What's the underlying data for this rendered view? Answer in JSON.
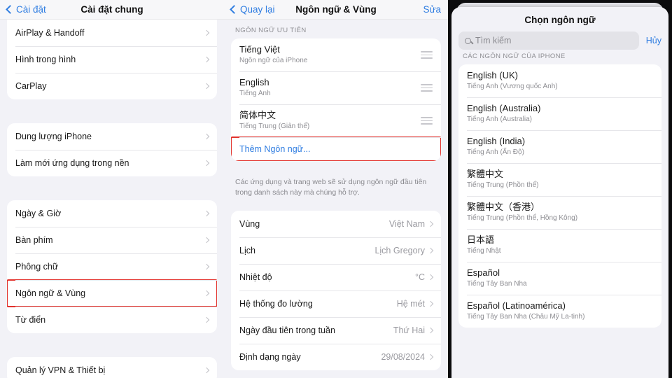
{
  "panels": {
    "left": {
      "nav": {
        "back_label": "Cài đặt",
        "title": "Cài đặt chung"
      },
      "groups": [
        {
          "rows": [
            {
              "label": "AirPlay & Handoff"
            },
            {
              "label": "Hình trong hình"
            },
            {
              "label": "CarPlay"
            }
          ]
        },
        {
          "rows": [
            {
              "label": "Dung lượng iPhone"
            },
            {
              "label": "Làm mới ứng dụng trong nền"
            }
          ]
        },
        {
          "rows": [
            {
              "label": "Ngày & Giờ"
            },
            {
              "label": "Bàn phím"
            },
            {
              "label": "Phông chữ"
            },
            {
              "label": "Ngôn ngữ & Vùng",
              "highlighted": true
            },
            {
              "label": "Từ điển"
            }
          ]
        },
        {
          "rows": [
            {
              "label": "Quản lý VPN & Thiết bị"
            }
          ]
        }
      ]
    },
    "middle": {
      "nav": {
        "back_label": "Quay lại",
        "title": "Ngôn ngữ & Vùng",
        "edit_label": "Sửa"
      },
      "section_header": "NGÔN NGỮ ƯU TIÊN",
      "languages": [
        {
          "name": "Tiếng Việt",
          "sub": "Ngôn ngữ của iPhone"
        },
        {
          "name": "English",
          "sub": "Tiếng Anh"
        },
        {
          "name": "简体中文",
          "sub": "Tiếng Trung (Giản thể)"
        }
      ],
      "add_language_label": "Thêm Ngôn ngữ...",
      "footer": "Các ứng dụng và trang web sẽ sử dụng ngôn ngữ đầu tiên trong danh sách này mà chúng hỗ trợ.",
      "region_rows": [
        {
          "label": "Vùng",
          "value": "Việt Nam"
        },
        {
          "label": "Lịch",
          "value": "Lịch Gregory"
        },
        {
          "label": "Nhiệt độ",
          "value": "°C"
        },
        {
          "label": "Hệ thống đo lường",
          "value": "Hệ mét"
        },
        {
          "label": "Ngày đầu tiên trong tuần",
          "value": "Thứ Hai"
        },
        {
          "label": "Định dạng ngày",
          "value": "29/08/2024"
        }
      ]
    },
    "right": {
      "title": "Chọn ngôn ngữ",
      "search_placeholder": "Tìm kiếm",
      "search_value": "",
      "cancel_label": "Hủy",
      "section_header": "CÁC NGÔN NGỮ CỦA IPHONE",
      "languages": [
        {
          "name": "English (UK)",
          "sub": "Tiếng Anh (Vương quốc Anh)"
        },
        {
          "name": "English (Australia)",
          "sub": "Tiếng Anh (Australia)"
        },
        {
          "name": "English (India)",
          "sub": "Tiếng Anh (Ấn Độ)"
        },
        {
          "name": "繁體中文",
          "sub": "Tiếng Trung (Phồn thể)"
        },
        {
          "name": "繁體中文（香港）",
          "sub": "Tiếng Trung (Phồn thể, Hồng Kông)"
        },
        {
          "name": "日本語",
          "sub": "Tiếng Nhật"
        },
        {
          "name": "Español",
          "sub": "Tiếng Tây Ban Nha"
        },
        {
          "name": "Español (Latinoamérica)",
          "sub": "Tiếng Tây Ban Nha (Châu Mỹ La-tinh)"
        }
      ]
    }
  },
  "colors": {
    "accent": "#2f7de1",
    "highlight": "#e2322c",
    "group_bg": "#ffffff",
    "page_bg": "#f2f2f7"
  }
}
